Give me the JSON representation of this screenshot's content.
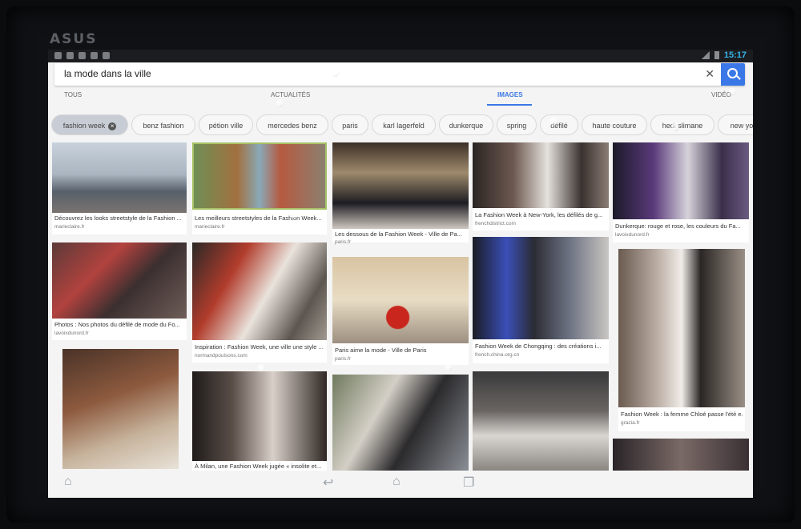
{
  "device": {
    "brand": "ASUS"
  },
  "status": {
    "time": "15:17"
  },
  "search": {
    "query": "la mode dans la ville",
    "clear_icon": "close-icon",
    "button_icon": "search-icon"
  },
  "tabs": [
    {
      "label": "TOUS",
      "active": false
    },
    {
      "label": "ACTUALITÉS",
      "active": false
    },
    {
      "label": "IMAGES",
      "active": true
    },
    {
      "label": "VIDÉO",
      "active": false
    }
  ],
  "chips": [
    "fashion week",
    "benz fashion",
    "pétion ville",
    "mercedes benz",
    "paris",
    "karl lagerfeld",
    "dunkerque",
    "spring",
    "défilé",
    "haute couture",
    "hedi slimane",
    "new yo"
  ],
  "results": [
    {
      "caption": "Découvrez les looks streetstyle de la Fashion ...",
      "source": "marieclaire.fr"
    },
    {
      "caption": "Les meilleurs streetstyles de la Fashion Week...",
      "source": "marieclaire.fr"
    },
    {
      "caption": "Les dessous de la Fashion Week - Ville de Pa...",
      "source": "paris.fr"
    },
    {
      "caption": "La Fashion Week à New-York, les défilés de g...",
      "source": "frenchdistrict.com"
    },
    {
      "caption": "Dunkerque: rouge et rose, les couleurs du Fa...",
      "source": "lavoixdunord.fr"
    },
    {
      "caption": "Photos : Nos photos du défilé de mode du Fo...",
      "source": "lavoixdunord.fr"
    },
    {
      "caption": "Inspiration : Fashion Week, une ville une style ...",
      "source": "normandpoulsons.com"
    },
    {
      "caption": "Paris aime la mode - Ville de Paris",
      "source": "paris.fr"
    },
    {
      "caption": "Fashion Week de Chongqing : des créations i...",
      "source": "french.china.org.cn"
    },
    {
      "caption": "Fashion Week : la femme Chloé passe l'été e...",
      "source": "grazia.fr"
    },
    {
      "caption": "À Milan, une Fashion Week jugée « insolite et...",
      "source": ""
    }
  ],
  "nav": {
    "back": "back-icon",
    "home": "home-icon",
    "recents": "recents-icon",
    "menu": "menu-icon"
  }
}
